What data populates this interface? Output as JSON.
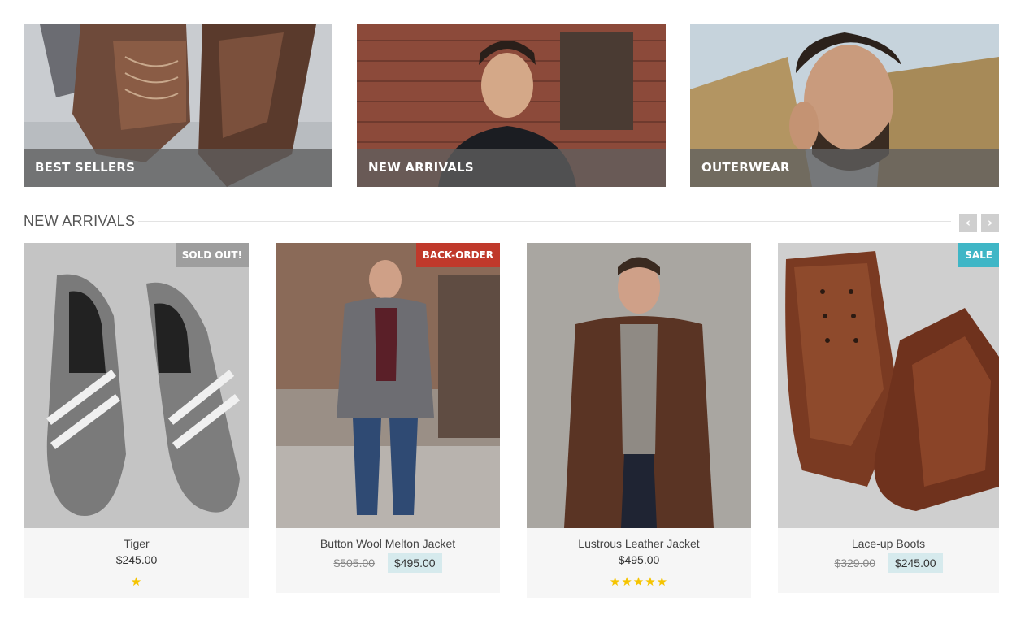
{
  "banners": [
    {
      "label": "BEST SELLERS"
    },
    {
      "label": "NEW ARRIVALS"
    },
    {
      "label": "OUTERWEAR"
    }
  ],
  "section": {
    "title": "NEW ARRIVALS",
    "prev_icon": "chevron-left-icon",
    "next_icon": "chevron-right-icon",
    "prev_glyph": "‹",
    "next_glyph": "›"
  },
  "products": [
    {
      "name": "Tiger",
      "price": "$245.00",
      "badge": "SOLD OUT!",
      "badge_color": "#9e9e9e",
      "rating": 1,
      "stars": "★"
    },
    {
      "name": "Button Wool Melton Jacket",
      "old_price": "$505.00",
      "price": "$495.00",
      "badge": "BACK-ORDER",
      "badge_color": "#c0392b"
    },
    {
      "name": "Lustrous Leather Jacket",
      "price": "$495.00",
      "rating": 5,
      "stars": "★★★★★"
    },
    {
      "name": "Lace-up Boots",
      "old_price": "$329.00",
      "price": "$245.00",
      "badge": "SALE",
      "badge_color": "#3fb6c6"
    }
  ],
  "colors": {
    "accent": "#3fb6c6",
    "sale_bg": "#d6eaed",
    "star": "#f5c400",
    "caption_bg": "#5f5f5f"
  }
}
